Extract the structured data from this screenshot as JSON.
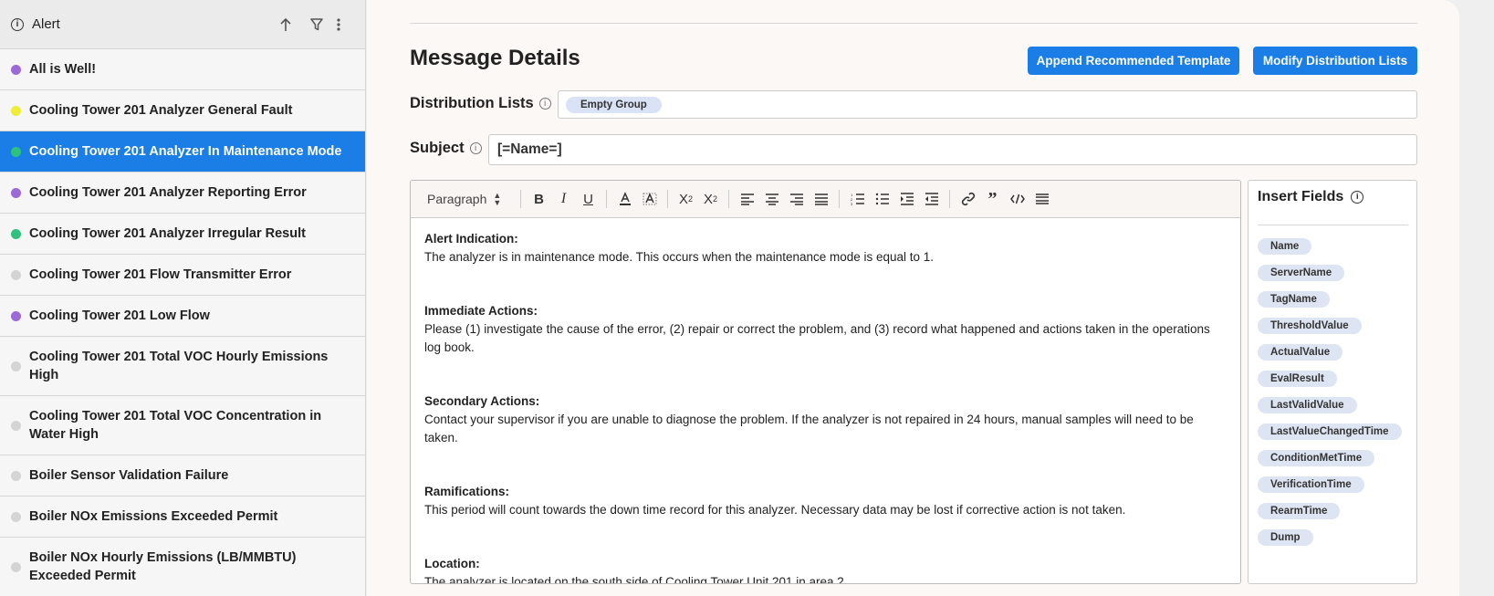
{
  "sidebar": {
    "title": "Alert",
    "items": [
      {
        "label": "All is Well!",
        "color": "#9b6ad8",
        "active": false,
        "tall": false
      },
      {
        "label": "Cooling Tower 201 Analyzer General Fault",
        "color": "#eded3a",
        "active": false,
        "tall": false
      },
      {
        "label": "Cooling Tower 201 Analyzer In Maintenance Mode",
        "color": "#2ec27e",
        "active": true,
        "tall": false
      },
      {
        "label": "Cooling Tower 201 Analyzer Reporting Error",
        "color": "#9b6ad8",
        "active": false,
        "tall": false
      },
      {
        "label": "Cooling Tower 201 Analyzer Irregular Result",
        "color": "#2ec27e",
        "active": false,
        "tall": false
      },
      {
        "label": "Cooling Tower 201 Flow Transmitter Error",
        "color": "#d4d4d4",
        "active": false,
        "tall": false
      },
      {
        "label": "Cooling Tower 201 Low Flow",
        "color": "#9b6ad8",
        "active": false,
        "tall": false
      },
      {
        "label": "Cooling Tower 201 Total VOC Hourly Emissions High",
        "color": "#d4d4d4",
        "active": false,
        "tall": true
      },
      {
        "label": "Cooling Tower 201 Total VOC Concentration in Water High",
        "color": "#d4d4d4",
        "active": false,
        "tall": true
      },
      {
        "label": "Boiler Sensor Validation Failure",
        "color": "#d4d4d4",
        "active": false,
        "tall": false
      },
      {
        "label": "Boiler NOx Emissions Exceeded Permit",
        "color": "#d4d4d4",
        "active": false,
        "tall": false
      },
      {
        "label": "Boiler NOx Hourly Emissions (LB/MMBTU) Exceeded Permit",
        "color": "#d4d4d4",
        "active": false,
        "tall": true
      }
    ]
  },
  "main": {
    "heading": "Message Details",
    "btn_template": "Append Recommended Template",
    "btn_distribution": "Modify Distribution Lists",
    "distribution_label": "Distribution Lists",
    "distribution_chip": "Empty Group",
    "subject_label": "Subject",
    "subject_value": "[=Name=]"
  },
  "editor": {
    "block_format": "Paragraph",
    "sections": [
      {
        "heading": "Alert Indication:",
        "body": "The analyzer is in maintenance mode. This occurs when the maintenance mode is equal to 1."
      },
      {
        "heading": "Immediate Actions:",
        "body": "Please (1) investigate the cause of the error, (2) repair or correct the problem, and (3) record what happened and actions taken in the operations log book."
      },
      {
        "heading": "Secondary Actions:",
        "body": "Contact your supervisor if you are unable to diagnose the problem. If the analyzer is not repaired in 24 hours, manual samples will need to be taken."
      },
      {
        "heading": "Ramifications:",
        "body": "This period will count towards the down time record for this analyzer. Necessary data may be lost if corrective action is not taken."
      },
      {
        "heading": "Location:",
        "body": "The analyzer is located on the south side of Cooling Tower Unit 201 in area 2."
      }
    ]
  },
  "insert_fields": {
    "title": "Insert Fields",
    "items": [
      "Name",
      "ServerName",
      "TagName",
      "ThresholdValue",
      "ActualValue",
      "EvalResult",
      "LastValidValue",
      "LastValueChangedTime",
      "ConditionMetTime",
      "VerificationTime",
      "RearmTime",
      "Dump"
    ]
  }
}
